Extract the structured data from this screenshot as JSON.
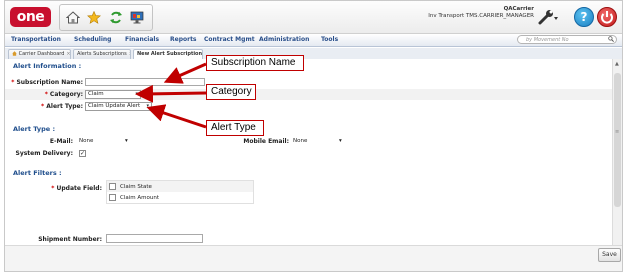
{
  "header": {
    "logo_text": "one",
    "user_name": "QACarrier",
    "user_org_role": "Inv Transport TMS.CARRIER_MANAGER",
    "help_label": "?"
  },
  "nav": {
    "items": [
      "Transportation",
      "Scheduling",
      "Financials",
      "Reports",
      "Contract Mgmt",
      "Administration",
      "Tools"
    ],
    "search_placeholder": "by Movement No"
  },
  "tabs": [
    {
      "label": "Carrier Dashboard",
      "close": "×"
    },
    {
      "label": "Alerts Subscriptions",
      "close": "×"
    },
    {
      "label": "New Alert Subscription",
      "close": "×"
    }
  ],
  "alert_information": {
    "title": "Alert Information :",
    "required_mark": "*",
    "subscription_name_label": "Subscription Name:",
    "subscription_name_value": "",
    "category_label": "Category:",
    "category_value": "Claim",
    "alert_type_label": "Alert Type:",
    "alert_type_value": "Claim Update Alert"
  },
  "alert_type_section": {
    "title": "Alert Type :",
    "email_label": "E-Mail:",
    "email_value": "None",
    "mobile_email_label": "Mobile Email:",
    "mobile_email_value": "None",
    "system_delivery_label": "System Delivery:",
    "system_delivery_checked": true
  },
  "alert_filters": {
    "title": "Alert Filters :",
    "update_field_label": "Update Field:",
    "options": [
      {
        "label": "Claim State",
        "checked": false
      },
      {
        "label": "Claim Amount",
        "checked": false
      }
    ],
    "shipment_number_label": "Shipment Number:",
    "shipment_number_value": ""
  },
  "callouts": {
    "subscription_name": "Subscription Name",
    "category": "Category",
    "alert_type": "Alert Type"
  },
  "footer": {
    "save_label": "Save"
  },
  "colors": {
    "brand_red": "#c8102e",
    "section_blue": "#1f4e8c",
    "callout_red": "#c00000"
  }
}
